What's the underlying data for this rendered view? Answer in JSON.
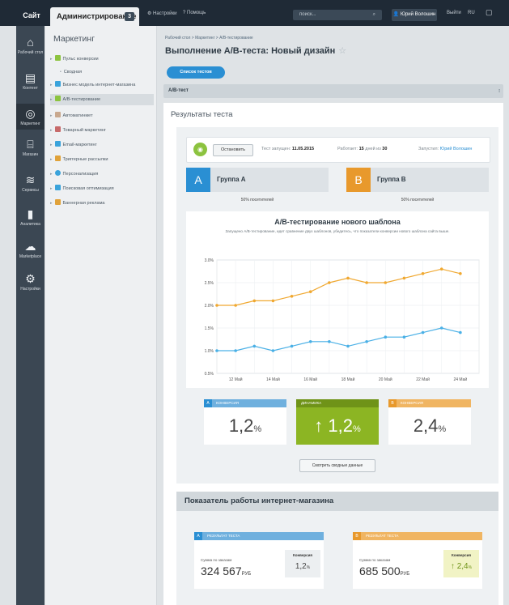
{
  "topbar": {
    "site": "Сайт",
    "admin": "Администрирование",
    "admin_count": "3",
    "settings": "Настройки",
    "help": "Помощь",
    "search_placeholder": "поиск...",
    "user": "Юрий Волошин",
    "logout": "Выйти",
    "lang": "RU"
  },
  "leftbar": [
    {
      "label": "Рабочий стол",
      "icon": "home-icon"
    },
    {
      "label": "Контент",
      "icon": "document-icon"
    },
    {
      "label": "Маркетинг",
      "icon": "target-icon"
    },
    {
      "label": "Магазин",
      "icon": "store-icon"
    },
    {
      "label": "Сервисы",
      "icon": "layers-icon"
    },
    {
      "label": "Аналитика",
      "icon": "analytics-icon"
    },
    {
      "label": "Marketplace",
      "icon": "cloud-icon"
    },
    {
      "label": "Настройки",
      "icon": "gear-icon"
    }
  ],
  "menu": {
    "title": "Маркетинг",
    "items": [
      {
        "label": "Пульс конверсии",
        "color": "#8cc33f"
      },
      {
        "label": "Сводная",
        "color": ""
      },
      {
        "label": "Бизнес модель интернет-магазина",
        "color": "#3aa3db"
      },
      {
        "label": "A/B-тестирование",
        "color": "#8cc33f"
      },
      {
        "label": "Автоматинмет",
        "color": "#c8a88e"
      },
      {
        "label": "Товарный маркетинг",
        "color": "#c76a6a"
      },
      {
        "label": "Email-маркетинг",
        "color": "#3aa3db"
      },
      {
        "label": "Триггерные рассылки",
        "color": "#e0a23a"
      },
      {
        "label": "Персонализация",
        "color": "#3aa3db"
      },
      {
        "label": "Поисковая оптимизация",
        "color": "#3aa3db"
      },
      {
        "label": "Баннерная реклама",
        "color": "#e0a23a"
      }
    ]
  },
  "breadcrumb": "Рабочий стол  >  Маркетинг  >  A/B-тестирование",
  "page_title": "Выполнение A/B-теста: Новый дизайн",
  "list_button": "Список тестов",
  "tab": "A/B-тест",
  "results_title": "Результаты теста",
  "status": {
    "stop_button": "Остановить",
    "started_label": "Тест запущен:",
    "started_date": "11.05.2015",
    "works_label": "Работает:",
    "works_days": "15",
    "works_of": "дней из",
    "works_total": "30",
    "launched_label": "Запустил:",
    "launched_by": "Юрий Волошин"
  },
  "groups": [
    {
      "letter": "A",
      "name": "Группа A",
      "share": "50% посетителей",
      "color": "#2a8fd3"
    },
    {
      "letter": "B",
      "name": "Группа B",
      "share": "50% посетителей",
      "color": "#e8992c"
    }
  ],
  "chart_data": {
    "type": "line",
    "title": "A/B-тестирование нового шаблона",
    "subtitle": "Запущено A/B-тестирование, идет сравнение двух шаблонов, убедитесь, что показатели конверсии нового шаблона сайта выше.",
    "x": [
      "11 Май",
      "12 Май",
      "13 Май",
      "14 Май",
      "15 Май",
      "16 Май",
      "17 Май",
      "18 Май",
      "19 Май",
      "20 Май",
      "21 Май",
      "22 Май",
      "23 Май",
      "24 Май",
      "25 Май"
    ],
    "x_ticks": [
      "12 Май",
      "14 Май",
      "16 Май",
      "18 Май",
      "20 Май",
      "22 Май",
      "24 Май"
    ],
    "y_ticks": [
      "0.5%",
      "1.0%",
      "1.5%",
      "2.0%",
      "2.5%",
      "3.0%"
    ],
    "ylim": [
      0.5,
      3.0
    ],
    "series": [
      {
        "values": [
          1.0,
          1.0,
          1.1,
          1.0,
          1.1,
          1.2,
          1.2,
          1.1,
          1.2,
          1.3,
          1.3,
          1.4,
          1.5,
          1.4
        ],
        "color": "#4ab0e6"
      },
      {
        "values": [
          2.0,
          2.0,
          2.1,
          2.1,
          2.2,
          2.3,
          2.5,
          2.6,
          2.5,
          2.5,
          2.6,
          2.7,
          2.8,
          2.7
        ],
        "color": "#f0a830"
      }
    ],
    "grid": true
  },
  "kpis": [
    {
      "letter": "A",
      "label": "КОНВЕРСИЯ",
      "value": "1,2",
      "unit": "%",
      "color": "#2a8fd3"
    },
    {
      "letter": "",
      "label": "ДИНАМИКА",
      "value": "↑ 1,2",
      "unit": "%",
      "color": "#8cb523"
    },
    {
      "letter": "B",
      "label": "КОНВЕРСИЯ",
      "value": "2,4",
      "unit": "%",
      "color": "#e8992c"
    }
  ],
  "summary_button": "Смотреть сводные данные",
  "shop_title": "Показатель работы интернет-магазина",
  "shop_cards": [
    {
      "letter": "A",
      "label": "РЕЗУЛЬТАТ ТЕСТА",
      "sum_label": "Сумма по заказам",
      "sum": "324 567",
      "currency": "РУБ",
      "conv_label": "Конверсия",
      "conv": "1,2",
      "conv_unit": "%"
    },
    {
      "letter": "B",
      "label": "РЕЗУЛЬТАТ ТЕСТА",
      "sum_label": "Сумма по заказам",
      "sum": "685 500",
      "currency": "РУБ",
      "conv_label": "Конверсия",
      "conv": "↑ 2,4",
      "conv_unit": "%"
    }
  ]
}
